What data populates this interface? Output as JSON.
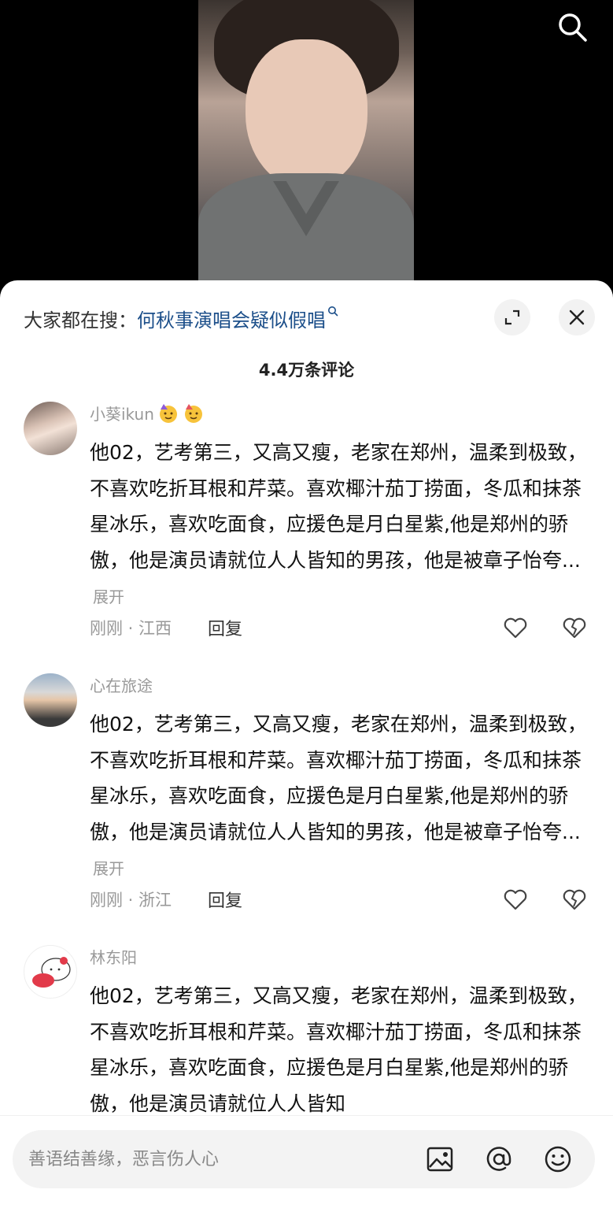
{
  "video": {
    "search_icon": "search-icon"
  },
  "hot_search": {
    "prefix": "大家都在搜：",
    "term": "何秋事演唱会疑似假唱",
    "term_icon": "search-icon",
    "expand_icon": "expand-icon",
    "close_icon": "close-icon"
  },
  "comments_count_title": "4.4万条评论",
  "comments": [
    {
      "username": "小葵ikun",
      "emojis": [
        "party-face-emoji",
        "party-face-emoji"
      ],
      "text": "他02，艺考第三，又高又瘦，老家在郑州，温柔到极致，不喜欢吃折耳根和芹菜。喜欢椰汁茄丁捞面，冬瓜和抹茶星冰乐，喜欢吃面食，应援色是月白星紫,他是郑州的骄傲，他是演员请就位人人皆知的男孩，他是被章子怡夸...",
      "more": "展开",
      "meta": "刚刚 · 江西",
      "reply": "回复"
    },
    {
      "username": "心在旅途",
      "emojis": [],
      "text": "他02，艺考第三，又高又瘦，老家在郑州，温柔到极致，不喜欢吃折耳根和芹菜。喜欢椰汁茄丁捞面，冬瓜和抹茶星冰乐，喜欢吃面食，应援色是月白星紫,他是郑州的骄傲，他是演员请就位人人皆知的男孩，他是被章子怡夸...",
      "more": "展开",
      "meta": "刚刚 · 浙江",
      "reply": "回复"
    },
    {
      "username": "林东阳",
      "emojis": [],
      "text": "他02，艺考第三，又高又瘦，老家在郑州，温柔到极致，不喜欢吃折耳根和芹菜。喜欢椰汁茄丁捞面，冬瓜和抹茶星冰乐，喜欢吃面食，应援色是月白星紫,他是郑州的骄傲，他是演员请就位人人皆知"
    }
  ],
  "input": {
    "placeholder": "善语结善缘，恶言伤人心",
    "image_icon": "image-icon",
    "mention_icon": "at-mention-icon",
    "emoji_icon": "emoji-icon"
  }
}
